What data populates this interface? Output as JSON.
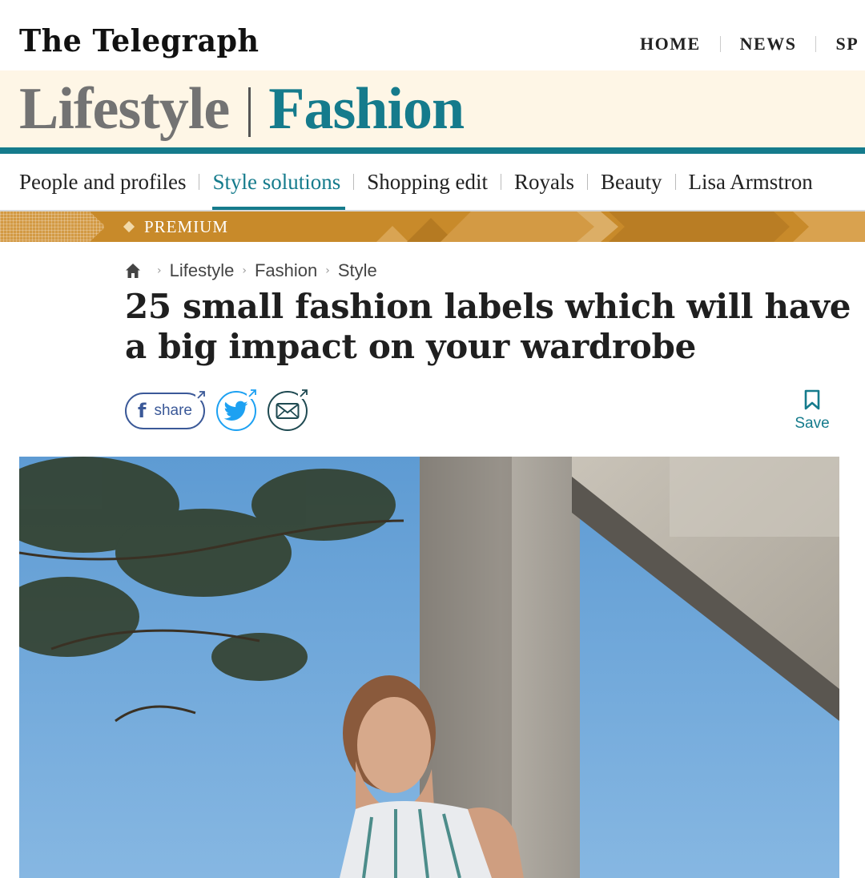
{
  "brand": {
    "logo_text": "The Telegraph"
  },
  "main_nav": {
    "items": [
      "HOME",
      "NEWS",
      "SP"
    ]
  },
  "section": {
    "parent": "Lifestyle",
    "current": "Fashion"
  },
  "sub_nav": {
    "items": [
      "People and profiles",
      "Style solutions",
      "Shopping edit",
      "Royals",
      "Beauty",
      "Lisa Armstron"
    ],
    "active_index": 1
  },
  "premium": {
    "label": "PREMIUM"
  },
  "breadcrumb": {
    "items": [
      "Lifestyle",
      "Fashion",
      "Style"
    ]
  },
  "article": {
    "headline": "25 small fashion labels which will have a big impact on your wardrobe"
  },
  "share": {
    "facebook_label": "share",
    "save_label": "Save"
  },
  "colors": {
    "accent": "#157b8c",
    "banner_bg": "#fef6e6",
    "premium": "#c88a2a",
    "facebook": "#3b5998",
    "twitter": "#1da1f2"
  },
  "icons": {
    "home": "home-icon",
    "facebook": "facebook-icon",
    "twitter": "twitter-icon",
    "email": "email-icon",
    "bookmark": "bookmark-icon"
  }
}
